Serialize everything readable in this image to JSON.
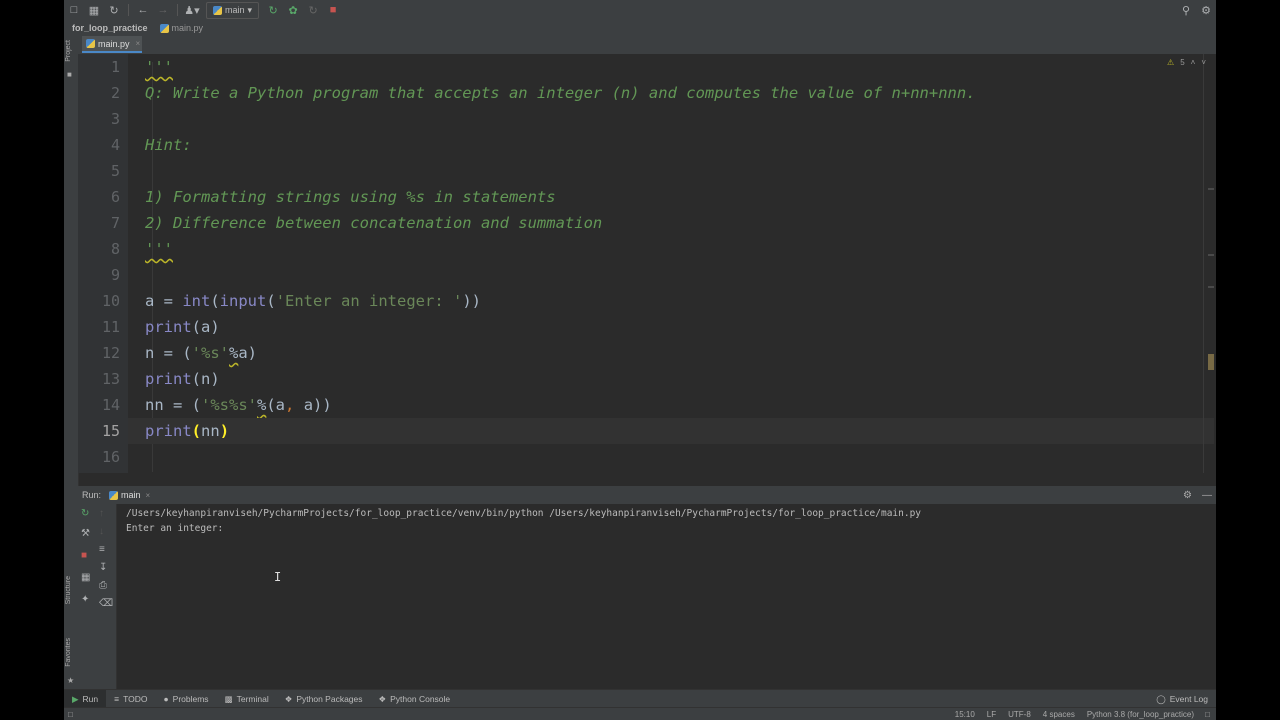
{
  "toolbar": {
    "run_config": "main",
    "icons": [
      "folder-icon",
      "save-icon",
      "sync-icon",
      "back-icon",
      "forward-icon",
      "user-icon",
      "run-icon",
      "debug-icon",
      "coverage-icon",
      "stop-icon",
      "search-icon",
      "settings-icon"
    ]
  },
  "breadcrumb": {
    "project": "for_loop_practice",
    "file": "main.py"
  },
  "left_strip": {
    "project_label": "Project",
    "structure_label": "Structure",
    "favorites_label": "Favorites"
  },
  "editor": {
    "tab": "main.py",
    "inspection_count": "5",
    "lines": [
      {
        "num": "1",
        "text": "'''"
      },
      {
        "num": "2",
        "text": "Q: Write a Python program that accepts an integer (n) and computes the value of n+nn+nnn."
      },
      {
        "num": "3",
        "text": ""
      },
      {
        "num": "4",
        "text": "Hint:"
      },
      {
        "num": "5",
        "text": ""
      },
      {
        "num": "6",
        "text": "1) Formatting strings using %s in statements"
      },
      {
        "num": "7",
        "text": "2) Difference between concatenation and summation"
      },
      {
        "num": "8",
        "text": "'''"
      },
      {
        "num": "9",
        "text": ""
      },
      {
        "num": "10",
        "parts": [
          "a = ",
          "int",
          "(",
          "input",
          "(",
          "'Enter an integer: '",
          "))"
        ]
      },
      {
        "num": "11",
        "parts": [
          "print",
          "(a)"
        ]
      },
      {
        "num": "12",
        "parts": [
          "n = (",
          "'%s'",
          "%",
          "a)"
        ]
      },
      {
        "num": "13",
        "parts": [
          "print",
          "(n)"
        ]
      },
      {
        "num": "14",
        "parts": [
          "nn = (",
          "'%s%s'",
          "%",
          "(a",
          ", ",
          "a))"
        ]
      },
      {
        "num": "15",
        "parts": [
          "print",
          "(",
          "nn",
          ")"
        ]
      },
      {
        "num": "16",
        "text": ""
      }
    ]
  },
  "run_panel": {
    "title": "Run:",
    "tab": "main",
    "console_lines": [
      "/Users/keyhanpiranviseh/PycharmProjects/for_loop_practice/venv/bin/python /Users/keyhanpiranviseh/PycharmProjects/for_loop_practice/main.py",
      "Enter an integer: "
    ]
  },
  "bottom_tabs": {
    "run": "Run",
    "todo": "TODO",
    "problems": "Problems",
    "terminal": "Terminal",
    "python_packages": "Python Packages",
    "python_console": "Python Console",
    "event_log": "Event Log"
  },
  "status": {
    "position": "15:10",
    "line_sep": "LF",
    "encoding": "UTF-8",
    "indent": "4 spaces",
    "interpreter": "Python 3.8 (for_loop_practice)"
  },
  "colors": {
    "docstring": "#629755",
    "builtin": "#8888c6",
    "string": "#6a8759",
    "default_text": "#a9b7c6",
    "brace_match": "#ffef28"
  }
}
